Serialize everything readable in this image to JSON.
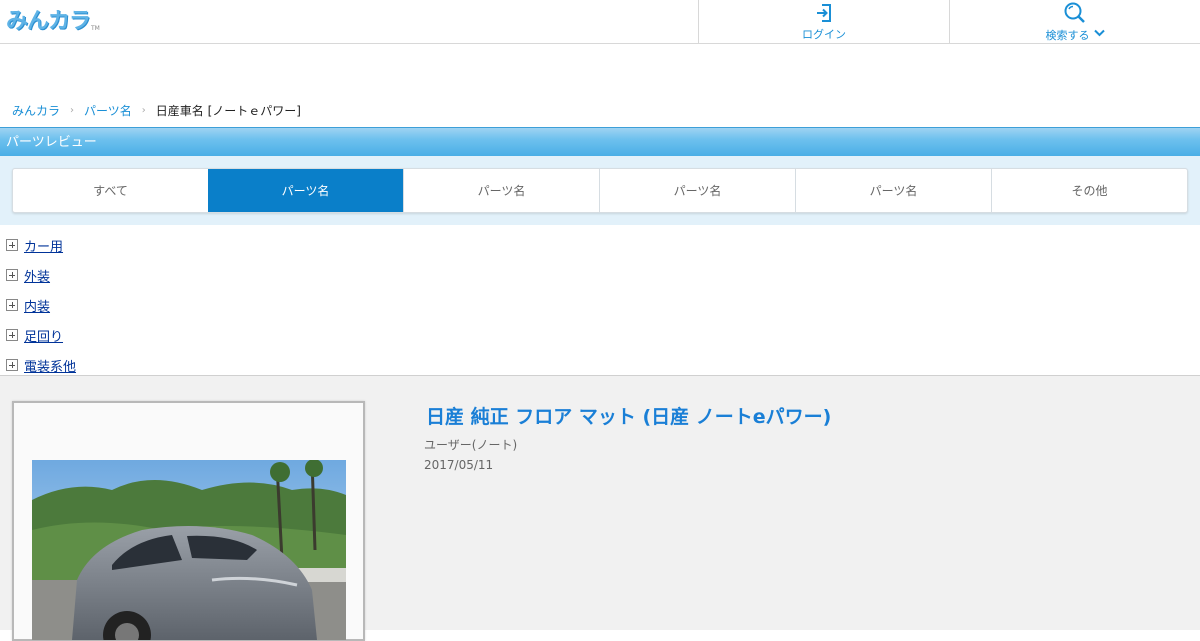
{
  "header": {
    "logo": "みんカラ",
    "logo_tm": "TM",
    "login_label": "ログイン",
    "search_label": "検索する"
  },
  "breadcrumb": [
    {
      "label": "みんカラ"
    },
    {
      "label": "パーツ名"
    },
    {
      "label": "日産車名 [ノートｅパワー]"
    }
  ],
  "section_title": "パーツレビュー",
  "tabs": [
    {
      "label": "すべて",
      "active": false
    },
    {
      "label": "パーツ名",
      "active": true
    },
    {
      "label": "パーツ名",
      "active": false
    },
    {
      "label": "パーツ名",
      "active": false
    },
    {
      "label": "パーツ名",
      "active": false
    },
    {
      "label": "その他",
      "active": false
    }
  ],
  "categories": [
    "カー用",
    "外装",
    "内装",
    "足回り",
    "電装系他"
  ],
  "post": {
    "title": "日産 純正 フロア マット (日産 ノートeパワー)",
    "author": "ユーザー(ノート)",
    "date": "2017/05/11"
  },
  "colors": {
    "accent": "#1a8fd6",
    "tab_active": "#0a7fc9",
    "section_bar": "#4aaee6",
    "link": "#003399",
    "post_title": "#1a7fd6"
  },
  "icons": {
    "login": "login-icon",
    "search": "search-icon",
    "chevron": "chevron-down-icon",
    "expand": "plus-box-icon"
  }
}
